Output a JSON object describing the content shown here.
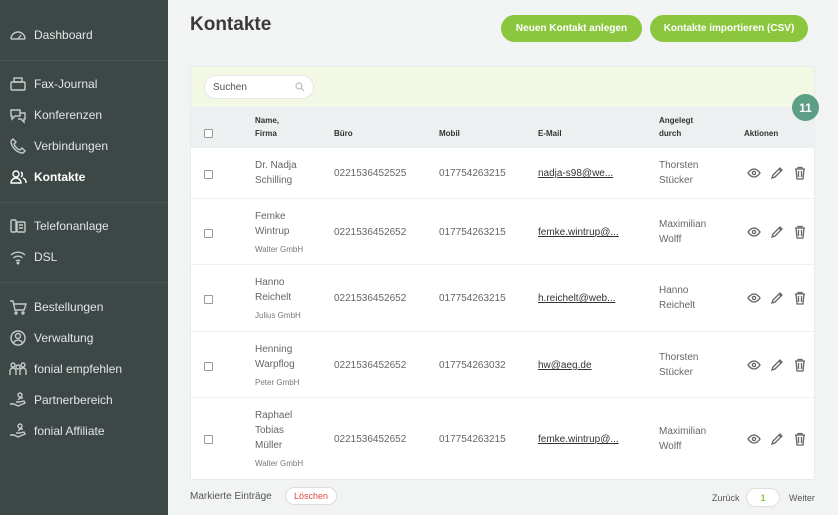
{
  "sidebar": {
    "items": [
      {
        "label": "Dashboard",
        "icon": "dashboard-icon"
      },
      {
        "label": "Fax-Journal",
        "icon": "fax-icon"
      },
      {
        "label": "Konferenzen",
        "icon": "conference-icon"
      },
      {
        "label": "Verbindungen",
        "icon": "phone-icon"
      },
      {
        "label": "Kontakte",
        "icon": "contacts-icon",
        "active": true
      },
      {
        "label": "Telefonanlage",
        "icon": "phone-system-icon"
      },
      {
        "label": "DSL",
        "icon": "wifi-icon"
      },
      {
        "label": "Bestellungen",
        "icon": "cart-icon"
      },
      {
        "label": "Verwaltung",
        "icon": "user-admin-icon"
      },
      {
        "label": "fonial empfehlen",
        "icon": "recommend-icon"
      },
      {
        "label": "Partnerbereich",
        "icon": "partner-icon"
      },
      {
        "label": "fonial Affiliate",
        "icon": "affiliate-icon"
      }
    ]
  },
  "header": {
    "title": "Kontakte",
    "new_contact_label": "Neuen Kontakt anlegen",
    "import_label": "Kontakte importieren (CSV)"
  },
  "search": {
    "placeholder": "Suchen"
  },
  "table": {
    "columns": {
      "name_line1": "Name,",
      "name_line2": "Firma",
      "office": "Büro",
      "mobile": "Mobil",
      "email": "E-Mail",
      "created_line1": "Angelegt",
      "created_line2": "durch",
      "actions": "Aktionen"
    },
    "rows": [
      {
        "name1": "Dr. Nadja",
        "name2": "Schilling",
        "name3": "",
        "company": "",
        "office": "0221536452525",
        "mobile": "017754263215",
        "email": "nadja-s98@we...",
        "by1": "Thorsten",
        "by2": "Stücker"
      },
      {
        "name1": "Femke",
        "name2": "Wintrup",
        "name3": "",
        "company": "Walter GmbH",
        "office": "0221536452652",
        "mobile": "017754263215",
        "email": "femke.wintrup@...",
        "by1": "Maximilian",
        "by2": "Wolff"
      },
      {
        "name1": "Hanno",
        "name2": "Reichelt",
        "name3": "",
        "company": "Julius GmbH",
        "office": "0221536452652",
        "mobile": "017754263215",
        "email": "h.reichelt@web...",
        "by1": "Hanno",
        "by2": "Reichelt"
      },
      {
        "name1": "Henning",
        "name2": "Warpflog",
        "name3": "",
        "company": "Peter GmbH",
        "office": "0221536452652",
        "mobile": "017754263032",
        "email": "hw@aeg.de",
        "by1": "Thorsten",
        "by2": "Stücker"
      },
      {
        "name1": "Raphael",
        "name2": "Tobias",
        "name3": "Müller",
        "company": "Walter GmbH",
        "office": "0221536452652",
        "mobile": "017754263215",
        "email": "femke.wintrup@...",
        "by1": "Maximilian",
        "by2": "Wolff"
      }
    ]
  },
  "badge": "11",
  "footer": {
    "marked_label": "Markierte Einträge",
    "delete_label": "Löschen",
    "prev_label": "Zurück",
    "page": "1",
    "next_label": "Weiter"
  },
  "colors": {
    "accent": "#8cc63f",
    "sidebar": "#3d4746",
    "badge": "#5d9e86",
    "delete": "#e04a4a"
  }
}
